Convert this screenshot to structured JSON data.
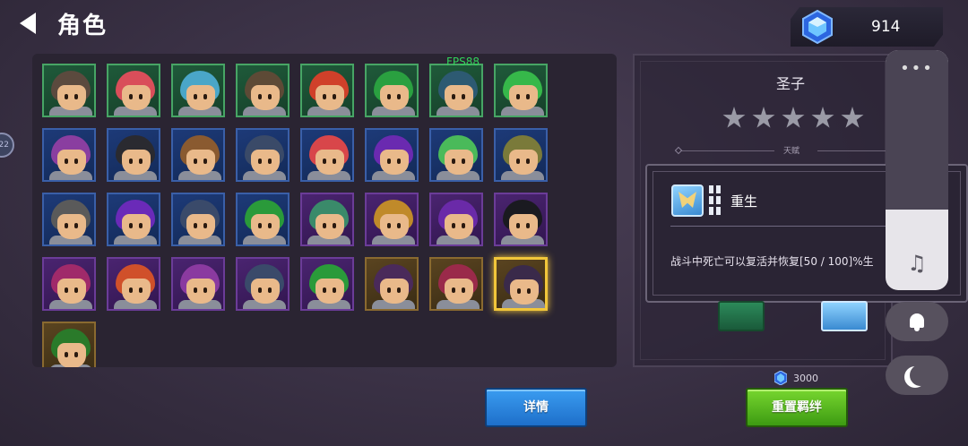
{
  "header": {
    "title": "角色"
  },
  "currency": {
    "gems": "914"
  },
  "side_badge": "22",
  "fps": "FPS88",
  "roster": {
    "slots": [
      {
        "border": "green",
        "hair": "#5b4a3e"
      },
      {
        "border": "green",
        "hair": "#d94e5a"
      },
      {
        "border": "green",
        "hair": "#4aa6c8"
      },
      {
        "border": "green",
        "hair": "#5d4a36"
      },
      {
        "border": "green",
        "hair": "#d0402a"
      },
      {
        "border": "green",
        "hair": "#2aa040"
      },
      {
        "border": "green",
        "hair": "#2d5a72"
      },
      {
        "border": "green",
        "hair": "#36b84a"
      },
      {
        "border": "blue",
        "hair": "#8a3ea0"
      },
      {
        "border": "blue",
        "hair": "#2a2a30"
      },
      {
        "border": "blue",
        "hair": "#8a5a30"
      },
      {
        "border": "blue",
        "hair": "#3a4a68"
      },
      {
        "border": "blue",
        "hair": "#d8464a"
      },
      {
        "border": "blue",
        "hair": "#6a2ab0"
      },
      {
        "border": "blue",
        "hair": "#4aba5a"
      },
      {
        "border": "blue",
        "hair": "#7a7a3a"
      },
      {
        "border": "blue",
        "hair": "#5a5a5a"
      },
      {
        "border": "blue",
        "hair": "#6a2ab8"
      },
      {
        "border": "blue",
        "hair": "#3a4a6a"
      },
      {
        "border": "blue",
        "hair": "#2a9a3a"
      },
      {
        "border": "purple",
        "hair": "#3a8a6a"
      },
      {
        "border": "purple",
        "hair": "#c08a2a"
      },
      {
        "border": "purple",
        "hair": "#6a2aa8"
      },
      {
        "border": "purple",
        "hair": "#1a1a20"
      },
      {
        "border": "purple",
        "hair": "#a02a6a"
      },
      {
        "border": "purple",
        "hair": "#d0502a"
      },
      {
        "border": "purple",
        "hair": "#8a3aa0"
      },
      {
        "border": "purple",
        "hair": "#3a4a6a"
      },
      {
        "border": "purple",
        "hair": "#2a9a3a"
      },
      {
        "border": "brown",
        "hair": "#4a2a5a"
      },
      {
        "border": "brown",
        "hair": "#9a2a4a"
      },
      {
        "border": "brown",
        "hair": "#3a2a4a",
        "selected": true
      },
      {
        "border": "brown",
        "hair": "#2a7a2a"
      }
    ]
  },
  "detail": {
    "name": "圣子",
    "stars": 5,
    "talent_label": "天赋",
    "skill": {
      "name": "重生",
      "desc": "战斗中死亡可以复活并恢复[50 / 100]%生"
    }
  },
  "controls": {
    "menu_dots": "•••",
    "music_icon": "♫"
  },
  "reset_cost": "3000",
  "buttons": {
    "detail": "详情",
    "reset": "重置羁绊"
  }
}
